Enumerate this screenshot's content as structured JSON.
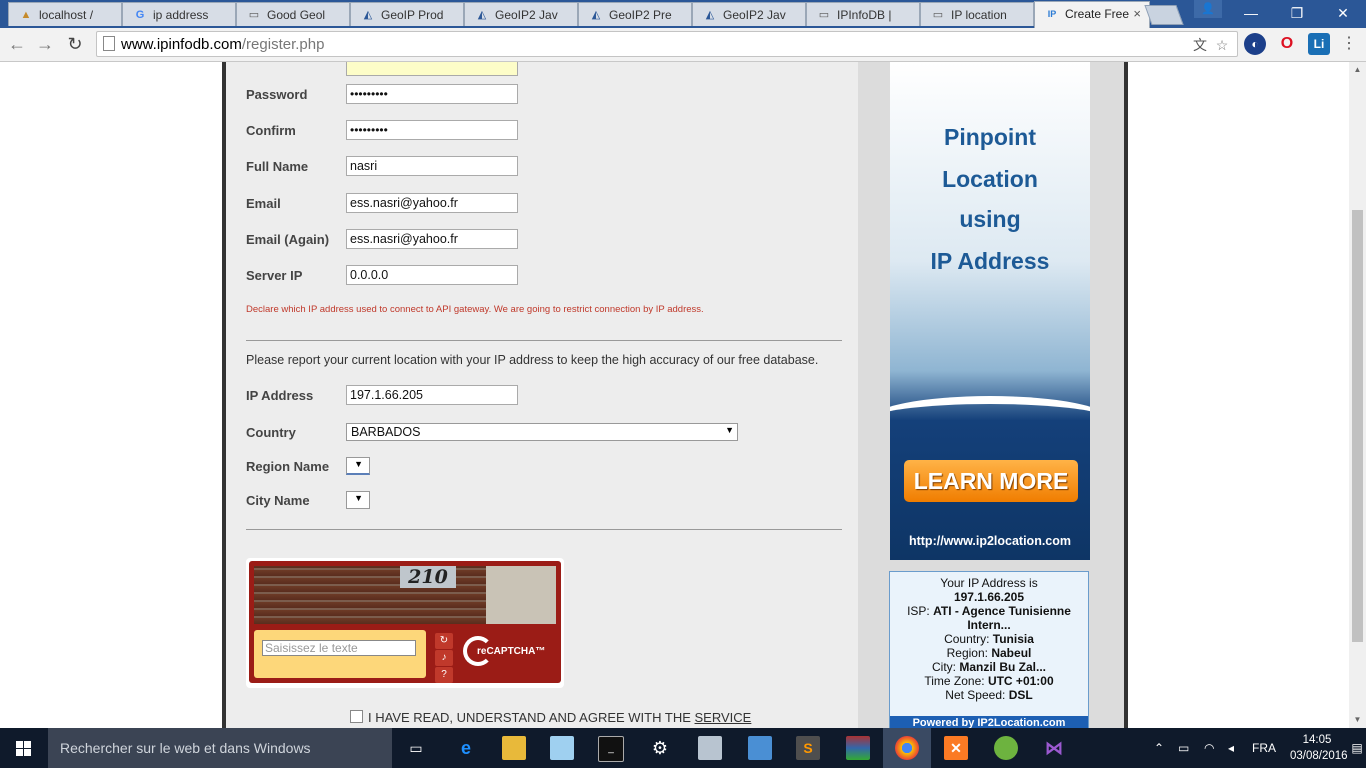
{
  "browser": {
    "tabs": [
      {
        "title": "localhost /",
        "icon": "phpmyadmin-icon",
        "active": false
      },
      {
        "title": "ip address",
        "icon": "google-icon",
        "active": false
      },
      {
        "title": "Good Geol",
        "icon": "page-icon",
        "active": false
      },
      {
        "title": "GeoIP Prod",
        "icon": "maxmind-icon",
        "active": false
      },
      {
        "title": "GeoIP2 Jav",
        "icon": "maxmind-icon",
        "active": false
      },
      {
        "title": "GeoIP2 Pre",
        "icon": "maxmind-icon",
        "active": false
      },
      {
        "title": "GeoIP2 Jav",
        "icon": "maxmind-icon",
        "active": false
      },
      {
        "title": "IPInfoDB |",
        "icon": "page-icon",
        "active": false
      },
      {
        "title": "IP location",
        "icon": "page-icon",
        "active": false
      },
      {
        "title": "Create Free",
        "icon": "ipinfodb-icon",
        "active": true
      }
    ],
    "url_host": "www.ipinfodb.com",
    "url_path": "/register.php",
    "extensions": [
      "translate-icon",
      "star-icon",
      "extension-earth-icon",
      "opera-icon",
      "linkedin-icon",
      "menu-icon"
    ],
    "accent": "#2b5797"
  },
  "form": {
    "username_value": "",
    "password_label": "Password",
    "password_value": "•••••••••",
    "confirm_label": "Confirm",
    "confirm_value": "•••••••••",
    "fullname_label": "Full Name",
    "fullname_value": "nasri",
    "email_label": "Email",
    "email_value": "ess.nasri@yahoo.fr",
    "email_again_label": "Email (Again)",
    "email_again_value": "ess.nasri@yahoo.fr",
    "serverip_label": "Server IP",
    "serverip_value": "0.0.0.0",
    "serverip_note": "Declare which IP address used to connect to API gateway. We are going to restrict connection by IP address.",
    "location_intro": "Please report your current location with your IP address to keep the high accuracy of our free database.",
    "ipaddress_label": "IP Address",
    "ipaddress_value": "197.1.66.205",
    "country_label": "Country",
    "country_value": "BARBADOS",
    "region_label": "Region Name",
    "city_label": "City Name",
    "captcha_number": "210",
    "captcha_placeholder": "Saisissez le texte",
    "recaptcha_brand": "reCAPTCHA™",
    "agree_text": "I HAVE READ, UNDERSTAND AND AGREE WITH THE",
    "agree_link": "SERVICE"
  },
  "ad": {
    "line1": "Pinpoint",
    "line2": "Location",
    "line3": "using",
    "line4": "IP Address",
    "button": "LEARN MORE",
    "url": "http://www.ip2location.com"
  },
  "ipinfo": {
    "heading": "Your IP Address is",
    "ip": "197.1.66.205",
    "isp_label": "ISP:",
    "isp": "ATI - Agence Tunisienne",
    "isp_cont": "Intern...",
    "country_label": "Country:",
    "country": "Tunisia",
    "region_label": "Region:",
    "region": "Nabeul",
    "city_label": "City:",
    "city": "Manzil Bu Zal...",
    "tz_label": "Time Zone:",
    "tz": "UTC +01:00",
    "speed_label": "Net Speed:",
    "speed": "DSL",
    "powered": "Powered by IP2Location.com"
  },
  "taskbar": {
    "search_placeholder": "Rechercher sur le web et dans Windows",
    "lang": "FRA",
    "time": "14:05",
    "date": "03/08/2016",
    "apps": [
      "task-view-icon",
      "edge-icon",
      "file-explorer-icon",
      "notepad-icon",
      "cmd-icon",
      "settings-icon",
      "scanner-icon",
      "remote-desktop-icon",
      "sublime-icon",
      "winrar-icon",
      "chrome-icon",
      "xampp-icon",
      "spring-icon",
      "visual-studio-icon"
    ]
  }
}
